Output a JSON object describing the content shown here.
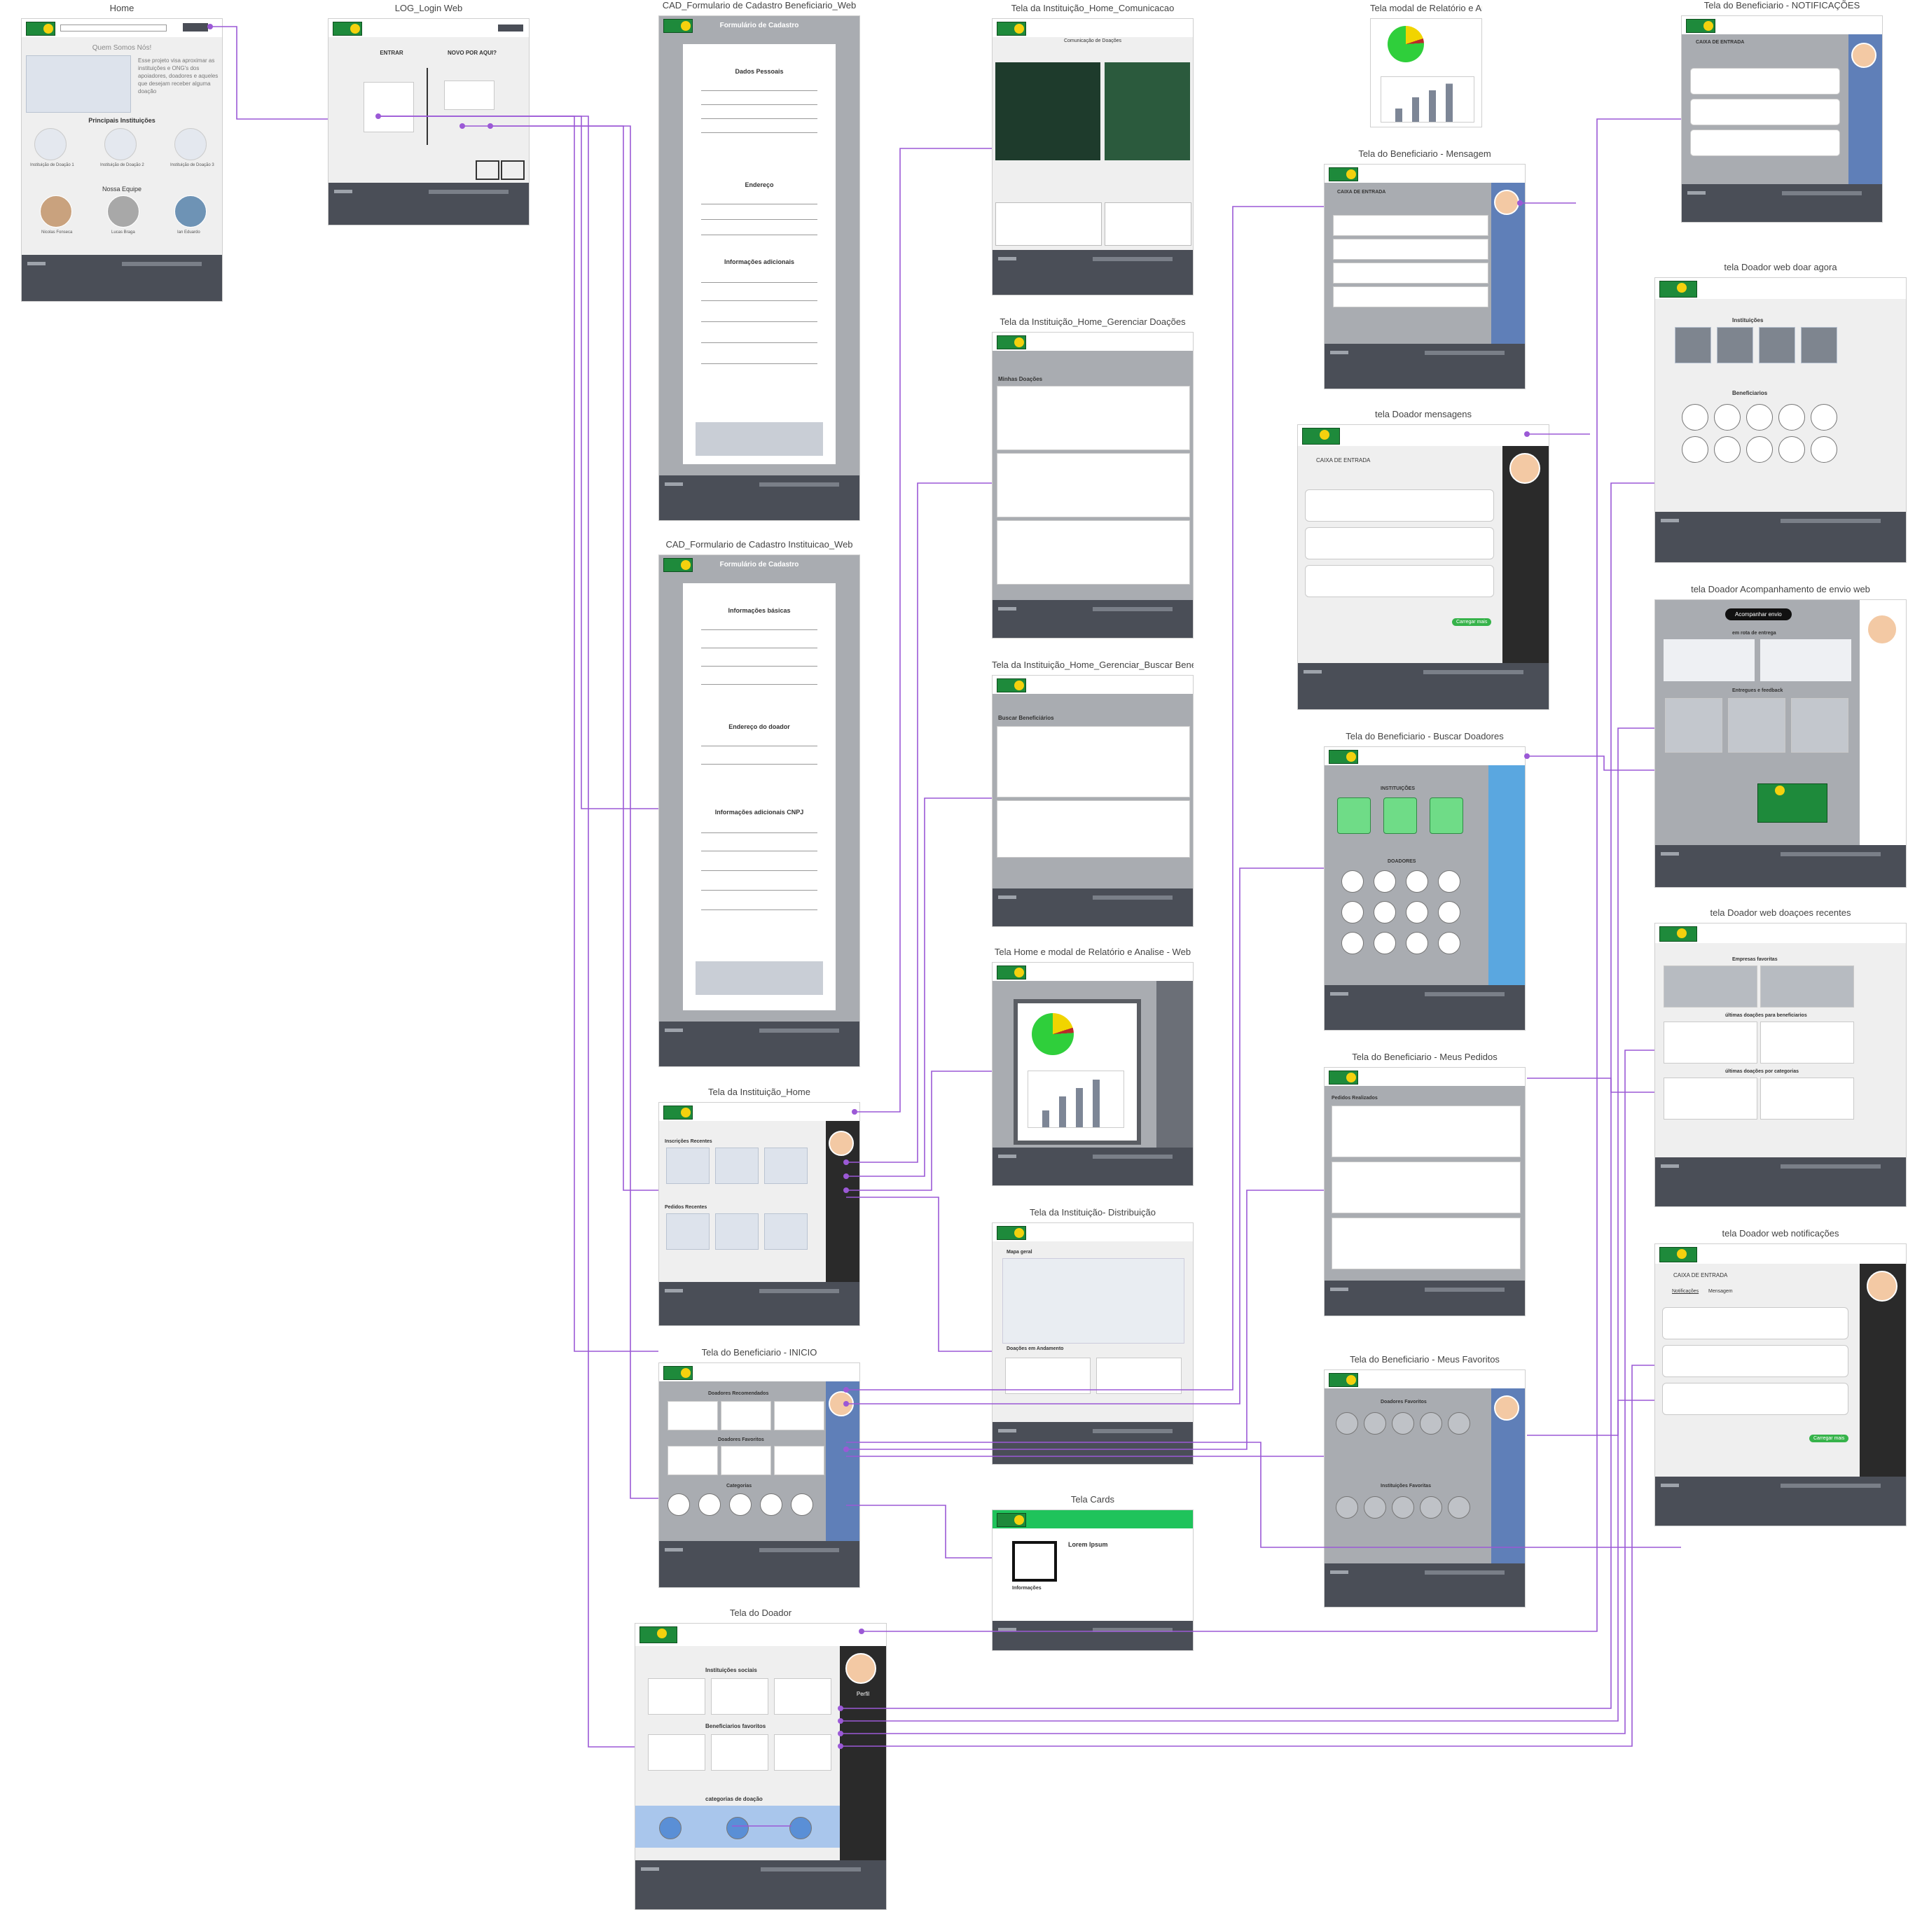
{
  "boards": {
    "home": {
      "title": "Home",
      "about": "Quem Somos Nós!",
      "about_text": "Esse projeto visa aproximar as instituições e ONG's dos apoiadores, doadores e aqueles que desejam receber alguma doação",
      "institutions_heading": "Principais Instituições",
      "institutions": [
        "Instituição de Doação 1",
        "Instituição de Doação 2",
        "Instituição de Doação 3"
      ],
      "team_heading": "Nossa Equipe",
      "team": [
        "Nicolas Fonseca",
        "Lucas Braga",
        "Ian Eduardo"
      ]
    },
    "login": {
      "title": "LOG_Login Web",
      "enter": "ENTRAR",
      "new": "NOVO POR AQUI?"
    },
    "cad_beneficiario": {
      "title": "CAD_Formulario de Cadastro Beneficiario_Web",
      "header": "Formulário de Cadastro",
      "sections": [
        "Dados Pessoais",
        "Endereço",
        "Informações adicionais"
      ]
    },
    "cad_instituicao": {
      "title": "CAD_Formulario de Cadastro Instituicao_Web",
      "header": "Formulário de Cadastro",
      "sections": [
        "Informações básicas",
        "Endereço do doador",
        "Informações adicionais CNPJ"
      ]
    },
    "inst_home": {
      "title": "Tela da Instituição_Home",
      "sections": [
        "Inscrições Recentes",
        "Pedidos Recentes"
      ]
    },
    "benef_inicio": {
      "title": "Tela do Beneficiario - INICIO",
      "sections": [
        "Doadores Recomendados",
        "Doadores Favoritos",
        "Categorias"
      ]
    },
    "doador": {
      "title": "Tela do Doador",
      "sections": [
        "Instituições sociais",
        "Beneficiarios favoritos",
        "categorias de doação"
      ],
      "profile": "Perfil"
    },
    "inst_comunicacao": {
      "title": "Tela da Instituição_Home_Comunicacao",
      "heading": "Comunicação de Doações"
    },
    "inst_gerenciar": {
      "title": "Tela da Instituição_Home_Gerenciar Doações",
      "heading": "Minhas Doações"
    },
    "inst_buscar": {
      "title": "Tela da Instituição_Home_Gerenciar_Buscar Beneficiários_Web",
      "heading": "Buscar Beneficiários"
    },
    "inst_relatorio": {
      "title": "Tela Home e modal de Relatório e Analise - Web"
    },
    "inst_distribuicao": {
      "title": "Tela da Instituição- Distribuição",
      "map": "Mapa geral",
      "andamento": "Doações em Andamento"
    },
    "cards": {
      "title": "Tela Cards",
      "name": "Lorem Ipsum",
      "info": "Informações"
    },
    "modal_relatorio": {
      "title": "Tela modal de Relatório e Analise - Web"
    },
    "benef_mensagem": {
      "title": "Tela do Beneficiario - Mensagem",
      "inbox": "CAIXA DE ENTRADA"
    },
    "doador_mensagens": {
      "title": "tela Doador mensagens",
      "inbox": "CAIXA DE ENTRADA",
      "more": "Carregar mais"
    },
    "benef_buscar": {
      "title": "Tela do Beneficiario - Buscar Doadores",
      "sections": [
        "INSTITUIÇÕES",
        "DOADORES"
      ]
    },
    "benef_pedidos": {
      "title": "Tela do Beneficiario - Meus Pedidos",
      "heading": "Pedidos Realizados"
    },
    "benef_favoritos": {
      "title": "Tela do Beneficiario - Meus Favoritos",
      "sections": [
        "Doadores Favoritos",
        "Instituições Favoritas"
      ]
    },
    "benef_notif": {
      "title": "Tela do Beneficiario - NOTIFICAÇÕES",
      "inbox": "CAIXA DE ENTRADA"
    },
    "doador_doar": {
      "title": "tela Doador web doar agora",
      "sections": [
        "Instituições",
        "Beneficiarios"
      ]
    },
    "doador_acomp": {
      "title": "tela Doador Acompanhamento de envio web",
      "button": "Acompanhar envio",
      "sections": [
        "em rota de entrega",
        "Entregues e feedback"
      ]
    },
    "doador_recentes": {
      "title": "tela Doador web doaçoes recentes",
      "sections": [
        "Empresas favoritas",
        "últimas doações para beneficiarios",
        "últimas doações por categorias"
      ]
    },
    "doador_notif": {
      "title": "tela Doador web notificações",
      "inbox": "CAIXA DE ENTRADA",
      "tabs": [
        "Notificações",
        "Mensagem"
      ],
      "more": "Carregar mais"
    }
  },
  "colors": {
    "connector": "#9b59d6",
    "footer": "#4a4e57",
    "sidebar_blue": "#5f7fb8",
    "sidebar_dark": "#2a2a2a",
    "brand_green": "#1e8a3b",
    "accent_green": "#36b34a"
  }
}
